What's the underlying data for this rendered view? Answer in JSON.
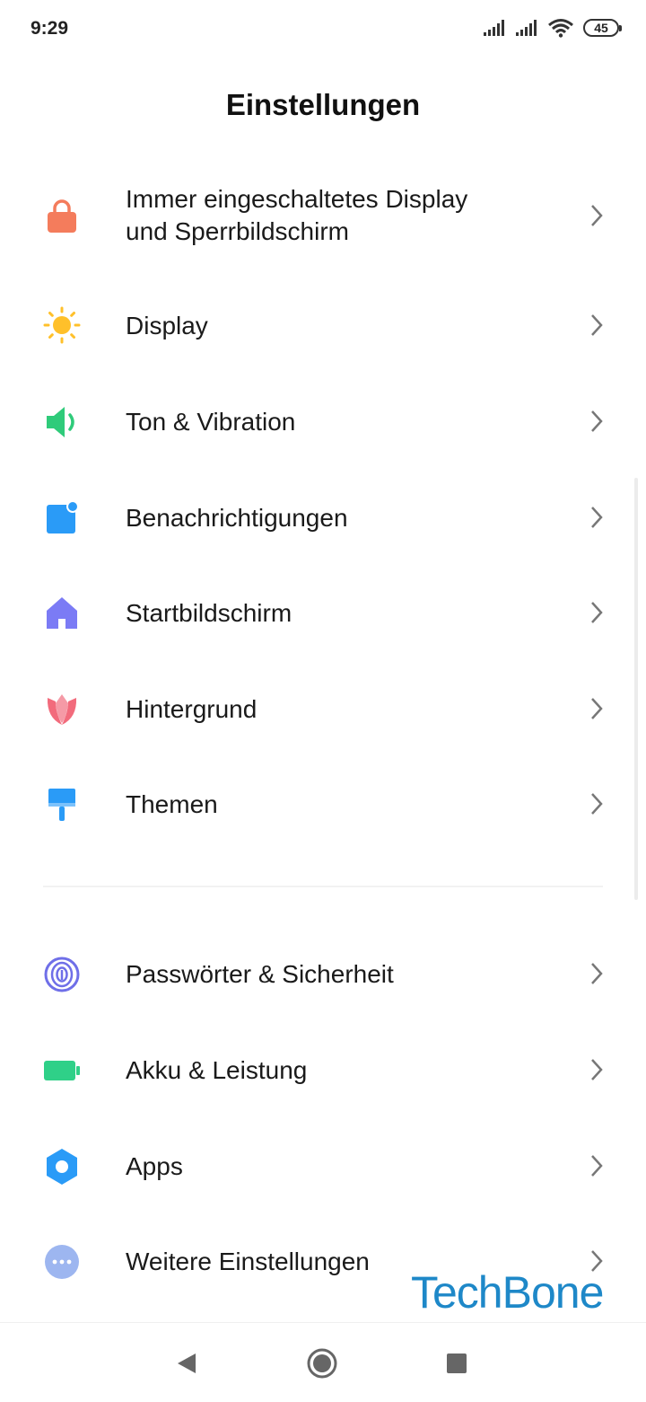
{
  "status": {
    "time": "9:29",
    "battery": "45"
  },
  "header": {
    "title": "Einstellungen"
  },
  "items": [
    {
      "label_line1": "Immer eingeschaltetes Display",
      "label_line2": "und Sperrbildschirm",
      "icon": "lock-icon",
      "color": "#F47C5C"
    },
    {
      "label": "Display",
      "icon": "sun-icon",
      "color": "#FFC02A"
    },
    {
      "label": "Ton & Vibration",
      "icon": "speaker-icon",
      "color": "#2FCB7A"
    },
    {
      "label": "Benachrichtigungen",
      "icon": "notification-icon",
      "color": "#2A9BF7"
    },
    {
      "label": "Startbildschirm",
      "icon": "home-icon",
      "color": "#7B7BF5"
    },
    {
      "label": "Hintergrund",
      "icon": "tulip-icon",
      "color": "#F26B7C"
    },
    {
      "label": "Themen",
      "icon": "paintbrush-icon",
      "color": "#2A9BF7"
    },
    {
      "label": "Passwörter & Sicherheit",
      "icon": "fingerprint-icon",
      "color": "#6F6FE8"
    },
    {
      "label": "Akku & Leistung",
      "icon": "battery-icon",
      "color": "#2FD088"
    },
    {
      "label": "Apps",
      "icon": "gear-icon",
      "color": "#2A9BF7"
    },
    {
      "label": "Weitere Einstellungen",
      "icon": "more-icon",
      "color": "#9DB6F0"
    }
  ],
  "watermark": {
    "text": "TechBone"
  }
}
